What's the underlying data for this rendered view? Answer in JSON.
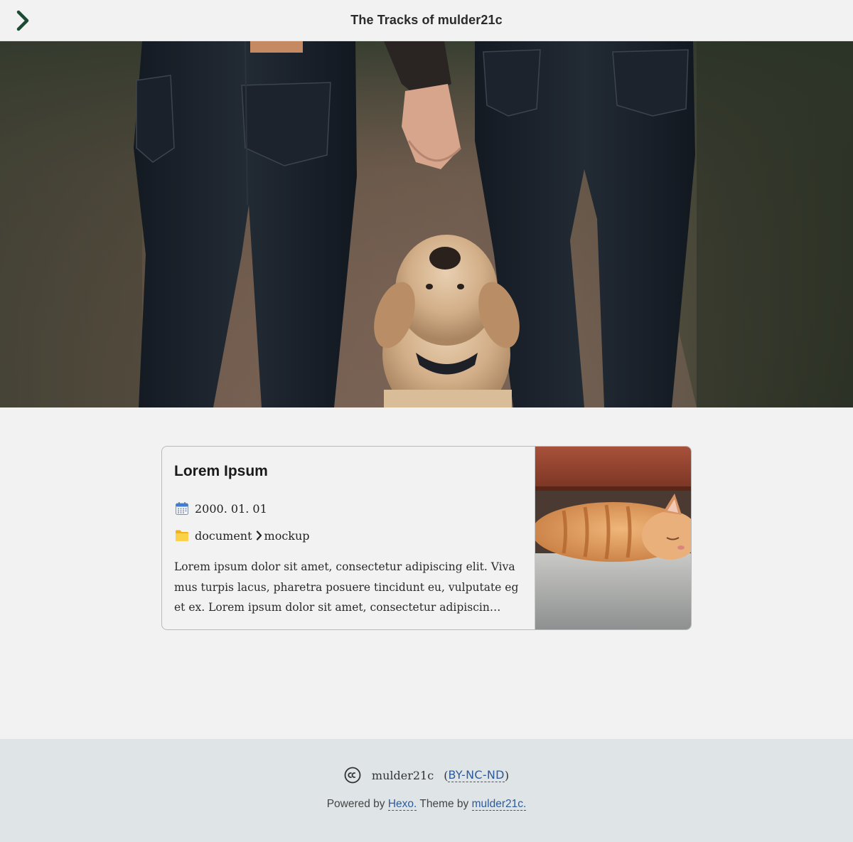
{
  "header": {
    "site_title": "The Tracks of mulder21c",
    "menu_icon": "chevron-right-icon",
    "accent_color": "#1d4a33"
  },
  "hero": {
    "image": "photo-couple-holding-hands-with-puppy"
  },
  "post": {
    "title": "Lorem Ipsum",
    "date": "2000. 01. 01",
    "date_icon": "calendar-icon",
    "category_icon": "folder-icon",
    "categories": [
      "document",
      "mockup"
    ],
    "category_separator_icon": "chevron-right-icon",
    "excerpt": "Lorem ipsum dolor sit amet, consectetur adipiscing elit. Vivamus turpis lacus, pharetra posuere tincidunt eu, vulputate eget ex. Lorem ipsum dolor sit amet, consectetur adipiscin…",
    "thumbnail": "photo-sleeping-orange-kitten"
  },
  "footer": {
    "license_icon": "creative-commons-icon",
    "author": "mulder21c",
    "license_open": "(",
    "license": "BY-NC-ND",
    "license_close": ")",
    "powered_prefix": "Powered by ",
    "hexo_link": "Hexo.",
    "theme_prefix": " Theme by ",
    "theme_link": "mulder21c.",
    "link_color": "#2d5a9a"
  }
}
